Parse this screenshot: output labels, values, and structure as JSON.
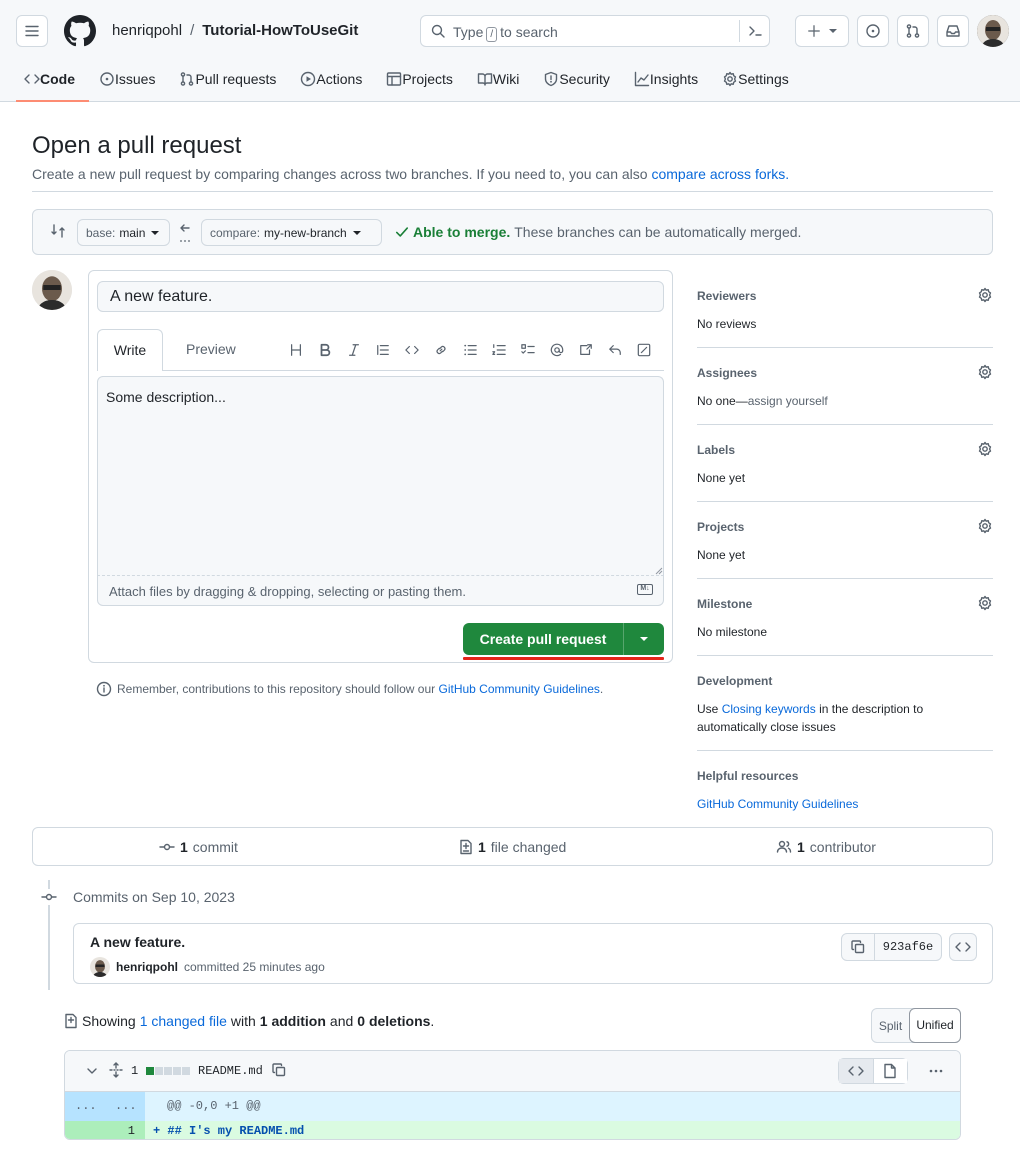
{
  "header": {
    "owner": "henriqpohl",
    "separator": "/",
    "repo": "Tutorial-HowToUseGit",
    "search": {
      "prefix": "Type",
      "key": "/",
      "suffix": "to search"
    }
  },
  "tabs": [
    {
      "label": "Code",
      "icon": "code-icon"
    },
    {
      "label": "Issues",
      "icon": "issue-icon"
    },
    {
      "label": "Pull requests",
      "icon": "pull-request-icon"
    },
    {
      "label": "Actions",
      "icon": "play-icon"
    },
    {
      "label": "Projects",
      "icon": "table-icon"
    },
    {
      "label": "Wiki",
      "icon": "book-icon"
    },
    {
      "label": "Security",
      "icon": "shield-icon"
    },
    {
      "label": "Insights",
      "icon": "graph-icon"
    },
    {
      "label": "Settings",
      "icon": "gear-icon"
    }
  ],
  "page": {
    "title": "Open a pull request",
    "subtitle": "Create a new pull request by comparing changes across two branches. If you need to, you can also",
    "subtitle_link": "compare across forks."
  },
  "branches": {
    "base_label": "base:",
    "base_value": "main",
    "compare_label": "compare:",
    "compare_value": "my-new-branch",
    "merge_status": "Able to merge.",
    "merge_text": "These branches can be automatically merged."
  },
  "form": {
    "title_value": "A new feature.",
    "tab_write": "Write",
    "tab_preview": "Preview",
    "body_value": "Some description...",
    "attach_text": "Attach files by dragging & dropping, selecting or pasting them.",
    "md_badge": "M↓",
    "create_label": "Create pull request",
    "remember_text": "Remember, contributions to this repository should follow our",
    "remember_link": "GitHub Community Guidelines",
    "remember_end": "."
  },
  "sidebar": {
    "reviewers": {
      "title": "Reviewers",
      "value": "No reviews"
    },
    "assignees": {
      "title": "Assignees",
      "value": "No one—",
      "link": "assign yourself"
    },
    "labels": {
      "title": "Labels",
      "value": "None yet"
    },
    "projects": {
      "title": "Projects",
      "value": "None yet"
    },
    "milestone": {
      "title": "Milestone",
      "value": "No milestone"
    },
    "development": {
      "title": "Development",
      "pre": "Use",
      "link": "Closing keywords",
      "post": "in the description to automatically close issues"
    },
    "resources": {
      "title": "Helpful resources",
      "link": "GitHub Community Guidelines"
    }
  },
  "stats": {
    "commits_n": "1",
    "commits_label": "commit",
    "files_n": "1",
    "files_label": "file changed",
    "contrib_n": "1",
    "contrib_label": "contributor"
  },
  "commits": {
    "date": "Commits on Sep 10, 2023",
    "message": "A new feature.",
    "author": "henriqpohl",
    "time": "committed 25 minutes ago",
    "sha": "923af6e"
  },
  "diffsummary": {
    "pre": "Showing",
    "link": "1 changed file",
    "mid": "with",
    "additions": "1 addition",
    "and": "and",
    "deletions": "0 deletions",
    "end": ".",
    "split": "Split",
    "unified": "Unified"
  },
  "file": {
    "count": "1",
    "name": "README.md",
    "hunk_left": "...",
    "hunk_right": "...",
    "hunk": "@@ -0,0 +1 @@",
    "line_no": "1",
    "line": "+ ## I's my README.md"
  },
  "colors": {
    "accent": "#0969da",
    "success": "#1f883d",
    "tab_underline": "#fd8c73",
    "highlight": "#e5251a"
  }
}
